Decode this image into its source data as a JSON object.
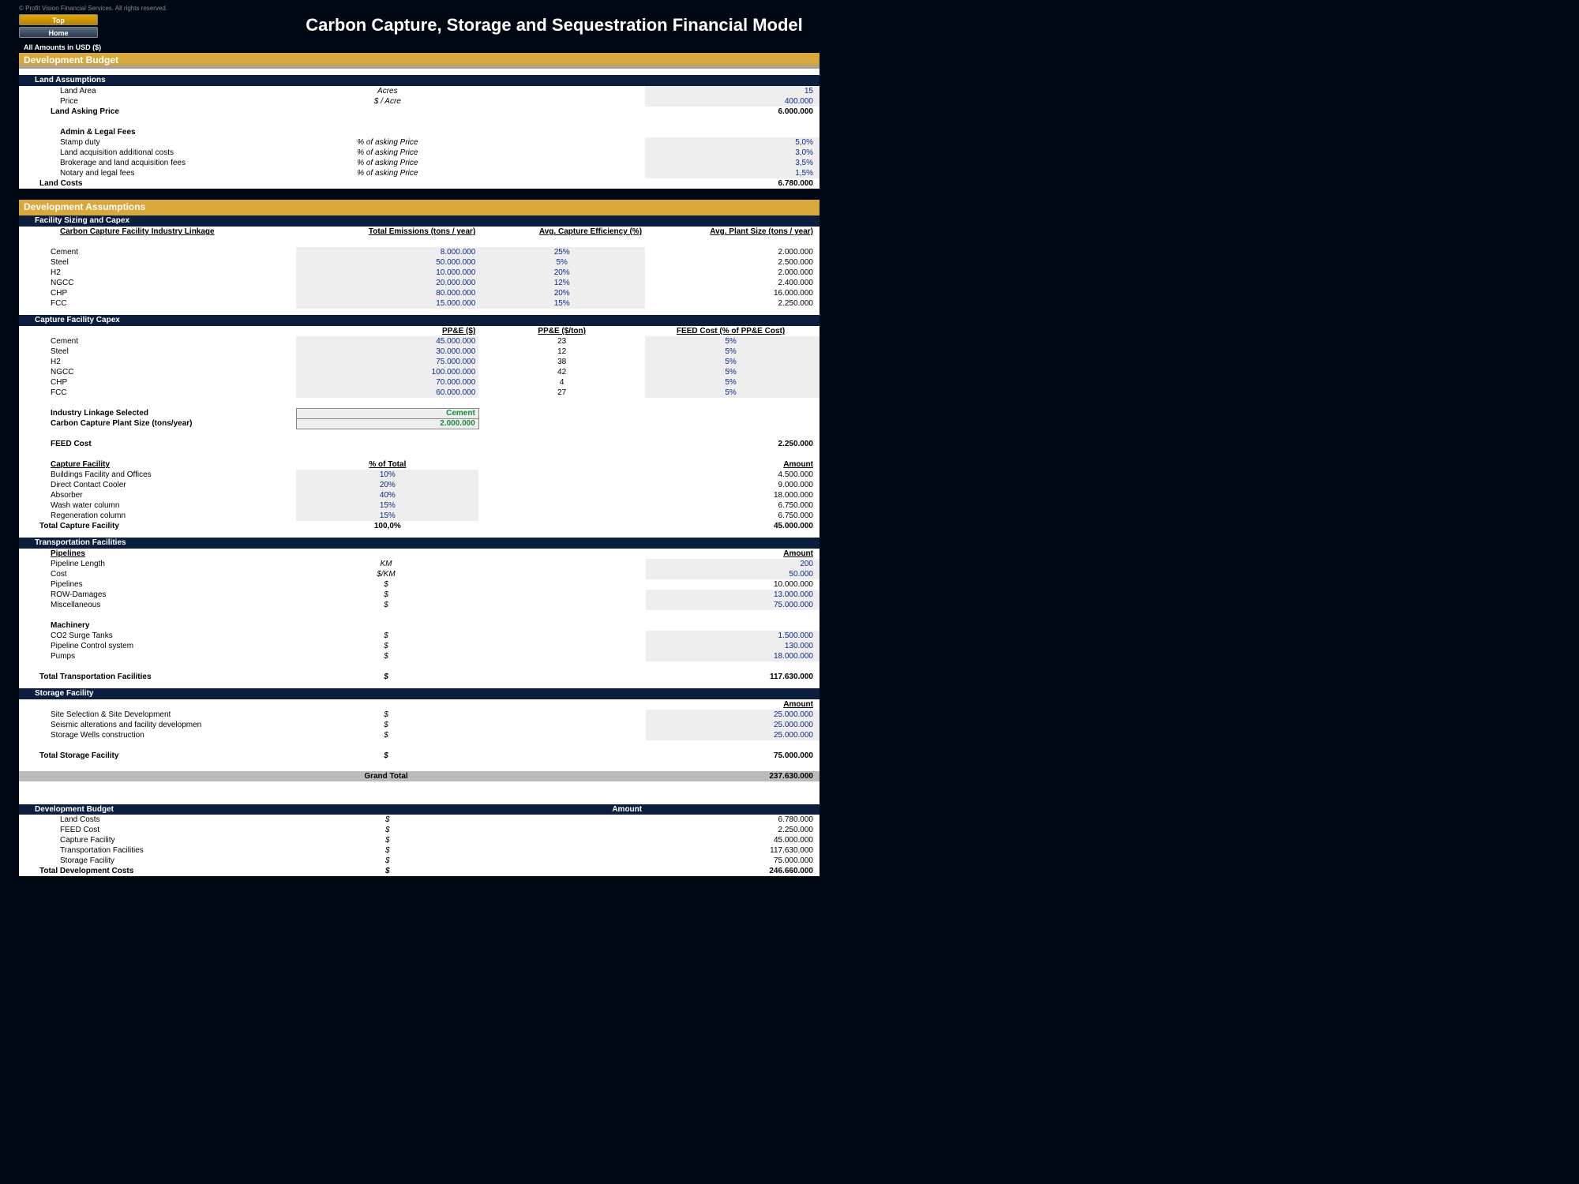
{
  "copyright": "© Profit Vision Financial Services. All rights reserved.",
  "nav": {
    "top": "Top",
    "home": "Home"
  },
  "title": "Carbon Capture, Storage and Sequestration Financial Model",
  "currency_note": "All Amounts in  USD ($)",
  "h": {
    "dev_budget": "Development Budget",
    "land_assump": "Land Assumptions",
    "dev_assump": "Development Assumptions",
    "sizing": "Facility Sizing and Capex",
    "capex": "Capture Facility Capex",
    "transport": "Transportation Facilities",
    "storage": "Storage Facility"
  },
  "land": {
    "area_l": "Land Area",
    "area_u": "Acres",
    "area_v": "15",
    "price_l": "Price",
    "price_u": "$ / Acre",
    "price_v": "400.000",
    "asking_l": "Land Asking Price",
    "asking_v": "6.000.000",
    "admin_l": "Admin & Legal Fees",
    "stamp_l": "Stamp duty",
    "stamp_u": "% of asking Price",
    "stamp_v": "5,0%",
    "acq_l": "Land acquisition additional costs",
    "acq_u": "% of asking Price",
    "acq_v": "3,0%",
    "broker_l": "Brokerage and land acquisition fees",
    "broker_u": "% of asking Price",
    "broker_v": "3,5%",
    "notary_l": "Notary and legal fees",
    "notary_u": "% of asking Price",
    "notary_v": "1,5%",
    "costs_l": "Land Costs",
    "costs_v": "6.780.000"
  },
  "sizing": {
    "h1": "Carbon Capture Facility Industry Linkage",
    "h2": "Total Emissions (tons / year)",
    "h3": "Avg. Capture Efficiency (%)",
    "h4": "Avg. Plant Size (tons / year)",
    "rows": [
      {
        "n": "Cement",
        "e": "8.000.000",
        "eff": "25%",
        "p": "2.000.000"
      },
      {
        "n": "Steel",
        "e": "50.000.000",
        "eff": "5%",
        "p": "2.500.000"
      },
      {
        "n": "H2",
        "e": "10.000.000",
        "eff": "20%",
        "p": "2.000.000"
      },
      {
        "n": "NGCC",
        "e": "20.000.000",
        "eff": "12%",
        "p": "2.400.000"
      },
      {
        "n": "CHP",
        "e": "80.000.000",
        "eff": "20%",
        "p": "16.000.000"
      },
      {
        "n": "FCC",
        "e": "15.000.000",
        "eff": "15%",
        "p": "2.250.000"
      }
    ]
  },
  "capex": {
    "h1": "PP&E ($)",
    "h2": "PP&E ($/ton)",
    "h3": "FEED Cost (% of PP&E Cost)",
    "rows": [
      {
        "n": "Cement",
        "a": "45.000.000",
        "b": "23",
        "c": "5%"
      },
      {
        "n": "Steel",
        "a": "30.000.000",
        "b": "12",
        "c": "5%"
      },
      {
        "n": "H2",
        "a": "75.000.000",
        "b": "38",
        "c": "5%"
      },
      {
        "n": "NGCC",
        "a": "100.000.000",
        "b": "42",
        "c": "5%"
      },
      {
        "n": "CHP",
        "a": "70.000.000",
        "b": "4",
        "c": "5%"
      },
      {
        "n": "FCC",
        "a": "60.000.000",
        "b": "27",
        "c": "5%"
      }
    ],
    "sel_l": "Industry Linkage Selected",
    "sel_v": "Cement",
    "size_l": "Carbon Capture Plant Size (tons/year)",
    "size_v": "2.000.000",
    "feed_l": "FEED Cost",
    "feed_v": "2.250.000"
  },
  "capture": {
    "h_l": "Capture Facility",
    "h_pct": "% of Total",
    "h_amt": "Amount",
    "rows": [
      {
        "n": "Buildings Facility and Offices",
        "p": "10%",
        "a": "4.500.000"
      },
      {
        "n": "Direct Contact Cooler",
        "p": "20%",
        "a": "9.000.000"
      },
      {
        "n": "Absorber",
        "p": "40%",
        "a": "18.000.000"
      },
      {
        "n": "Wash water column",
        "p": "15%",
        "a": "6.750.000"
      },
      {
        "n": "Regeneration column",
        "p": "15%",
        "a": "6.750.000"
      }
    ],
    "tot_l": "Total Capture Facility",
    "tot_p": "100,0%",
    "tot_a": "45.000.000"
  },
  "trans": {
    "pipe_l": "Pipelines",
    "amt_l": "Amount",
    "len_l": "Pipeline Length",
    "len_u": "KM",
    "len_v": "200",
    "cost_l": "Cost",
    "cost_u": "$/KM",
    "cost_v": "50.000",
    "pipes_l": "Pipelines",
    "pipes_u": "$",
    "pipes_v": "10.000.000",
    "row_l": "ROW-Damages",
    "row_u": "$",
    "row_v": "13.000.000",
    "misc_l": "Miscellaneous",
    "misc_u": "$",
    "misc_v": "75.000.000",
    "mach_l": "Machinery",
    "surge_l": "CO2 Surge Tanks",
    "surge_u": "$",
    "surge_v": "1.500.000",
    "ctrl_l": "Pipeline Control system",
    "ctrl_u": "$",
    "ctrl_v": "130.000",
    "pumps_l": "Pumps",
    "pumps_u": "$",
    "pumps_v": "18.000.000",
    "tot_l": "Total Transportation Facilities",
    "tot_u": "$",
    "tot_v": "117.630.000"
  },
  "storage": {
    "amt_l": "Amount",
    "r1_l": "Site Selection & Site Development",
    "r1_u": "$",
    "r1_v": "25.000.000",
    "r2_l": "Seismic alterations and facility developmen",
    "r2_u": "$",
    "r2_v": "25.000.000",
    "r3_l": "Storage Wells construction",
    "r3_u": "$",
    "r3_v": "25.000.000",
    "tot_l": "Total Storage Facility",
    "tot_u": "$",
    "tot_v": "75.000.000",
    "grand_l": "Grand Total",
    "grand_v": "237.630.000"
  },
  "summary": {
    "h_l": "Development Budget",
    "h_amt": "Amount",
    "rows": [
      {
        "n": "Land Costs",
        "u": "$",
        "a": "6.780.000"
      },
      {
        "n": "FEED Cost",
        "u": "$",
        "a": "2.250.000"
      },
      {
        "n": "Capture Facility",
        "u": "$",
        "a": "45.000.000"
      },
      {
        "n": "Transportation Facilities",
        "u": "$",
        "a": "117.630.000"
      },
      {
        "n": "Storage Facility",
        "u": "$",
        "a": "75.000.000"
      }
    ],
    "tot_l": "Total Development Costs",
    "tot_u": "$",
    "tot_v": "246.660.000"
  }
}
